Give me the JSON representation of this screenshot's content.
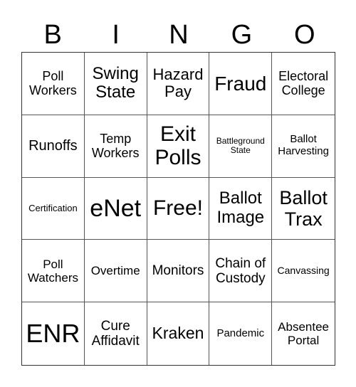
{
  "header": [
    "B",
    "I",
    "N",
    "G",
    "O"
  ],
  "cells": [
    {
      "text": "Poll Workers",
      "size": 18
    },
    {
      "text": "Swing State",
      "size": 24
    },
    {
      "text": "Hazard Pay",
      "size": 22
    },
    {
      "text": "Fraud",
      "size": 28
    },
    {
      "text": "Electoral College",
      "size": 18
    },
    {
      "text": "Runoffs",
      "size": 20
    },
    {
      "text": "Temp Workers",
      "size": 18
    },
    {
      "text": "Exit Polls",
      "size": 30
    },
    {
      "text": "Battleground State",
      "size": 12
    },
    {
      "text": "Ballot Harvesting",
      "size": 15
    },
    {
      "text": "Certification",
      "size": 13
    },
    {
      "text": "eNet",
      "size": 34
    },
    {
      "text": "Free!",
      "size": 30
    },
    {
      "text": "Ballot Image",
      "size": 24
    },
    {
      "text": "Ballot Trax",
      "size": 27
    },
    {
      "text": "Poll Watchers",
      "size": 17
    },
    {
      "text": "Overtime",
      "size": 17
    },
    {
      "text": "Monitors",
      "size": 19
    },
    {
      "text": "Chain of Custody",
      "size": 19
    },
    {
      "text": "Canvassing",
      "size": 14
    },
    {
      "text": "ENR",
      "size": 36
    },
    {
      "text": "Cure Affidavit",
      "size": 19
    },
    {
      "text": "Kraken",
      "size": 23
    },
    {
      "text": "Pandemic",
      "size": 15
    },
    {
      "text": "Absentee Portal",
      "size": 17
    }
  ]
}
